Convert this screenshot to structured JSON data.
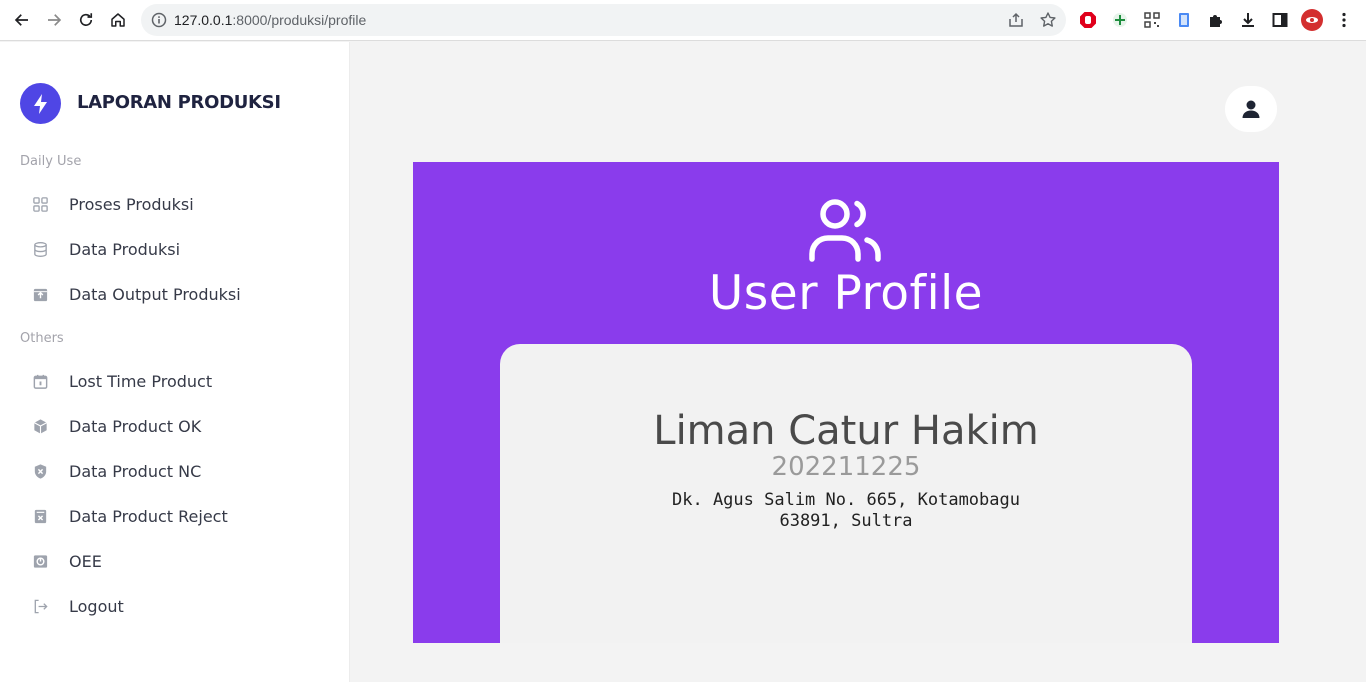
{
  "browser": {
    "url_host": "127.0.0.1",
    "url_path": ":8000/produksi/profile"
  },
  "sidebar": {
    "brand": "LAPORAN PRODUKSI",
    "sections": [
      {
        "label": "Daily Use"
      },
      {
        "label": "Others"
      }
    ],
    "items": [
      {
        "label": "Proses Produksi",
        "icon": "grid-icon"
      },
      {
        "label": "Data Produksi",
        "icon": "database-icon"
      },
      {
        "label": "Data Output Produksi",
        "icon": "archive-icon"
      },
      {
        "label": "Lost Time Product",
        "icon": "calendar-icon"
      },
      {
        "label": "Data Product OK",
        "icon": "cube-icon"
      },
      {
        "label": "Data Product NC",
        "icon": "shield-x-icon"
      },
      {
        "label": "Data Product Reject",
        "icon": "file-x-icon"
      },
      {
        "label": "OEE",
        "icon": "chart-square-icon"
      },
      {
        "label": "Logout",
        "icon": "logout-icon"
      }
    ]
  },
  "main": {
    "banner_title": "User Profile",
    "profile": {
      "name": "Liman Catur Hakim",
      "id": "202211225",
      "address_line1": "Dk. Agus Salim No. 665, Kotamobagu",
      "address_line2": "63891, Sultra"
    }
  },
  "colors": {
    "accent": "#8a3cec",
    "brand": "#4f46e5"
  }
}
